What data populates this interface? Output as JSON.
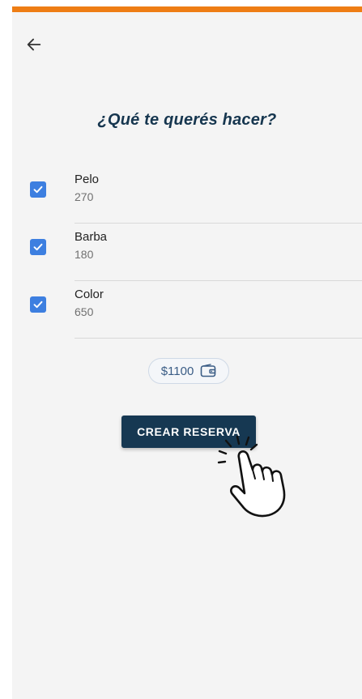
{
  "header": {
    "back_icon": "arrow-left-icon"
  },
  "title": "¿Qué te querés hacer?",
  "services": [
    {
      "name": "Pelo",
      "price": "270",
      "checked": true
    },
    {
      "name": "Barba",
      "price": "180",
      "checked": true
    },
    {
      "name": "Color",
      "price": "650",
      "checked": true
    }
  ],
  "total": {
    "amount": "$1100",
    "icon": "wallet-icon"
  },
  "cta": {
    "label": "CREAR RESERVA"
  },
  "overlay": {
    "icon": "tap-hand-icon"
  },
  "colors": {
    "accent_bar": "#ee7d14",
    "primary": "#163852",
    "checkbox": "#3d7fe0",
    "background": "#f4f4f4"
  }
}
